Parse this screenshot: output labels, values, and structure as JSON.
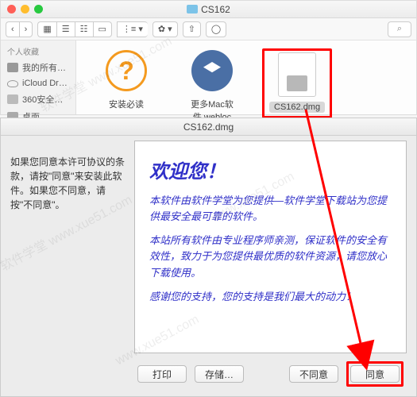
{
  "finder": {
    "window_title": "CS162",
    "sidebar": {
      "heading": "个人收藏",
      "items": [
        {
          "label": "我的所有…"
        },
        {
          "label": "iCloud Dr…"
        },
        {
          "label": "360安全…"
        },
        {
          "label": "桌面"
        }
      ]
    },
    "files": [
      {
        "label": "安装必读"
      },
      {
        "label": "更多Mac软件.webloc"
      },
      {
        "label": "CS162.dmg"
      }
    ]
  },
  "dialog": {
    "title": "CS162.dmg",
    "side_text": "如果您同意本许可协议的条款，请按\"同意\"来安装此软件。如果您不同意，请按\"不同意\"。",
    "license": {
      "welcome": "欢迎您！",
      "p1": "本软件由软件学堂为您提供—软件学堂下载站为您提供最安全最可靠的软件。",
      "p2": "本站所有软件由专业程序师亲测，保证软件的安全有效性，致力于为您提供最优质的软件资源，请您放心下载使用。",
      "p3": "感谢您的支持，您的支持是我们最大的动力！"
    },
    "buttons": {
      "print": "打印",
      "save": "存储…",
      "disagree": "不同意",
      "agree": "同意"
    }
  },
  "colors": {
    "highlight": "#ff0000",
    "license_text": "#3030c8"
  }
}
